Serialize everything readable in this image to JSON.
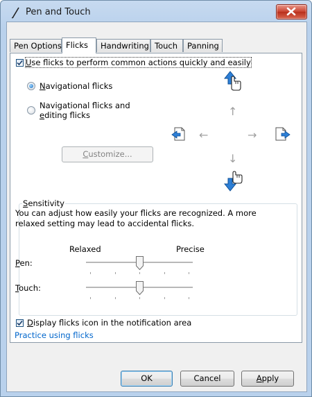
{
  "window": {
    "title": "Pen and Touch"
  },
  "tabs": [
    {
      "label": "Pen Options"
    },
    {
      "label": "Flicks"
    },
    {
      "label": "Handwriting"
    },
    {
      "label": "Touch"
    },
    {
      "label": "Panning"
    }
  ],
  "flicks": {
    "use_flicks_label": "Use flicks to perform common actions quickly and easily",
    "use_flicks_checked": true,
    "nav_flicks_label": "Navigational flicks",
    "nav_edit_flicks_label_line1": "Navigational flicks and",
    "nav_edit_flicks_label_line2": "editing flicks",
    "selected_mode": "Navigational flicks",
    "customize_label": "Customize..."
  },
  "sensitivity": {
    "group_label": "Sensitivity",
    "description_line1": "You can adjust how easily your flicks are recognized. A more",
    "description_line2": "relaxed setting may lead to accidental flicks.",
    "relaxed_label": "Relaxed",
    "precise_label": "Precise",
    "pen_label": "Pen:",
    "touch_label": "Touch:",
    "pen_level_fraction": 0.5,
    "touch_level_fraction": 0.5,
    "tick_count": 5
  },
  "notification": {
    "display_icon_label": "Display flicks icon in the notification area",
    "display_icon_checked": true
  },
  "practice_link": "Practice using flicks",
  "buttons": {
    "ok": "OK",
    "cancel": "Cancel",
    "apply": "Apply"
  },
  "icons": {
    "title": "pen-icon",
    "flick_up": "flick-up-hand-icon",
    "flick_down": "flick-down-hand-icon",
    "flick_left": "flick-back-page-icon",
    "flick_right": "flick-forward-page-icon"
  },
  "colors": {
    "accent": "#1e6fc0",
    "link": "#0066cc",
    "close": "#c9432f"
  }
}
